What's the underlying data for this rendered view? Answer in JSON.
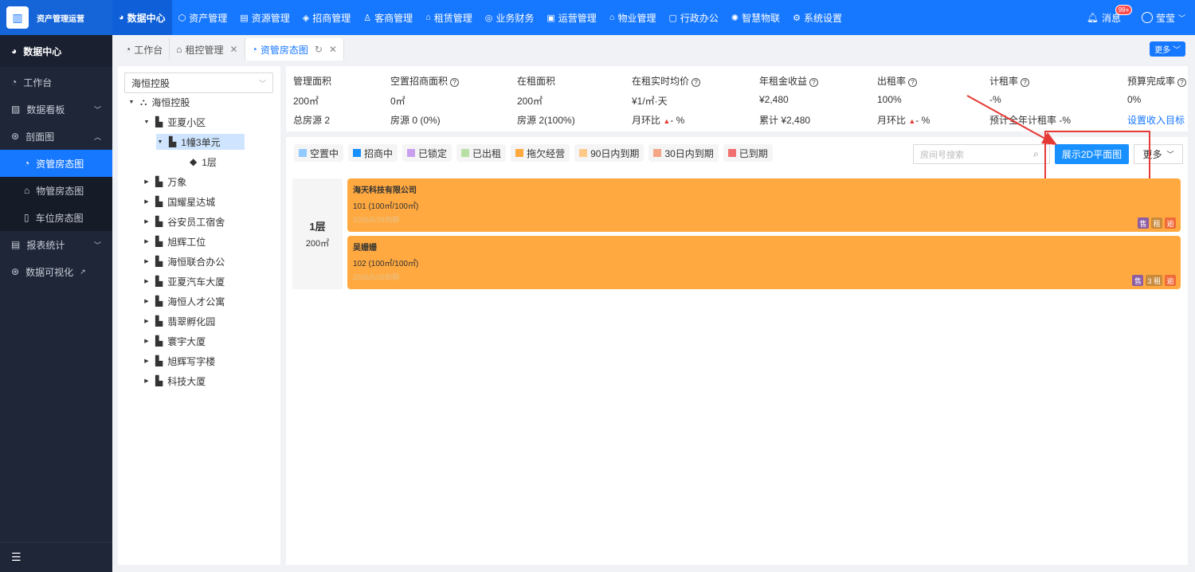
{
  "app": {
    "title": "资产管理运营"
  },
  "topnav": [
    {
      "label": "数据中心",
      "icon": "◕",
      "active": true
    },
    {
      "label": "资产管理",
      "icon": "⬡"
    },
    {
      "label": "资源管理",
      "icon": "▤"
    },
    {
      "label": "招商管理",
      "icon": "◈"
    },
    {
      "label": "客商管理",
      "icon": "♙"
    },
    {
      "label": "租赁管理",
      "icon": "⌂"
    },
    {
      "label": "业务财务",
      "icon": "◎"
    },
    {
      "label": "运营管理",
      "icon": "▣"
    },
    {
      "label": "物业管理",
      "icon": "⌂"
    },
    {
      "label": "行政办公",
      "icon": "▢"
    },
    {
      "label": "智慧物联",
      "icon": "✺"
    },
    {
      "label": "系统设置",
      "icon": "⚙"
    }
  ],
  "header": {
    "messages_label": "消息",
    "messages_badge": "99+",
    "user_name": "莹莹"
  },
  "sidebar": {
    "head": "数据中心",
    "items": [
      {
        "label": "工作台"
      },
      {
        "label": "数据看板"
      },
      {
        "label": "剖面图"
      },
      {
        "label": "资管房态图"
      },
      {
        "label": "物管房态图"
      },
      {
        "label": "车位房态图"
      },
      {
        "label": "报表统计"
      },
      {
        "label": "数据可视化"
      }
    ]
  },
  "tabs": [
    {
      "label": "工作台"
    },
    {
      "label": "租控管理"
    },
    {
      "label": "资管房态图"
    }
  ],
  "tabs_more": "更多",
  "tree": {
    "select_value": "海恒控股",
    "root": "海恒控股",
    "community": "亚夏小区",
    "unit": "1幢3单元",
    "floor": "1层",
    "others": [
      "万象",
      "国耀星达城",
      "谷安员工宿舍",
      "旭辉工位",
      "海恒联合办公",
      "亚夏汽车大厦",
      "海恒人才公寓",
      "翡翠孵化园",
      "寰宇大厦",
      "旭辉写字楼",
      "科技大厦"
    ]
  },
  "stats": {
    "cols": [
      {
        "r1": "管理面积",
        "r2": "200㎡",
        "r3": "总房源 2"
      },
      {
        "r1": "空置招商面积",
        "r2": "0㎡",
        "r3": "房源 0 (0%)"
      },
      {
        "r1": "在租面积",
        "r2": "200㎡",
        "r3": "房源 2(100%)"
      },
      {
        "r1": "在租实时均价",
        "r2": "¥1/㎡·天",
        "r3": "月环比"
      },
      {
        "r1": "年租金收益",
        "r2": "¥2,480",
        "r3": "累计 ¥2,480"
      },
      {
        "r1": "出租率",
        "r2": "100%",
        "r3": "月环比"
      },
      {
        "r1": "计租率",
        "r2": "-%",
        "r3": "预计全年计租率 -%"
      },
      {
        "r1": "预算完成率",
        "r2": "0%",
        "r3": "设置收入目标"
      }
    ],
    "trend_value": "- %"
  },
  "legend": [
    {
      "label": "空置中",
      "color": "#91caff"
    },
    {
      "label": "招商中",
      "color": "#1890ff"
    },
    {
      "label": "已锁定",
      "color": "#c9a0f0"
    },
    {
      "label": "已出租",
      "color": "#b7e0a5"
    },
    {
      "label": "拖欠经营",
      "color": "#ffa940"
    },
    {
      "label": "90日内到期",
      "color": "#ffc98a"
    },
    {
      "label": "30日内到期",
      "color": "#f4a686"
    },
    {
      "label": "已到期",
      "color": "#f07070"
    }
  ],
  "search": {
    "placeholder": "房间号搜索"
  },
  "actions": {
    "show2d": "展示2D平面图",
    "more": "更多"
  },
  "floor": {
    "name": "1层",
    "area": "200㎡"
  },
  "rooms": [
    {
      "tenant": "海天科技有限公司",
      "info": "101 (100㎡/100㎡)",
      "expire": "2026/5/26到期",
      "tags": [
        "售",
        "租",
        "逾"
      ]
    },
    {
      "tenant": "吴姗姗",
      "info": "102 (100㎡/100㎡)",
      "expire": "2026/5/26到期",
      "tags": [
        "售",
        "3 租",
        "逾"
      ]
    }
  ],
  "colors": {
    "primary": "#1677ff",
    "overdue": "#ffa940",
    "tag_sale": "#8e5ea2",
    "tag_rent": "#c98a3c",
    "tag_overdue": "#f06a3a"
  }
}
